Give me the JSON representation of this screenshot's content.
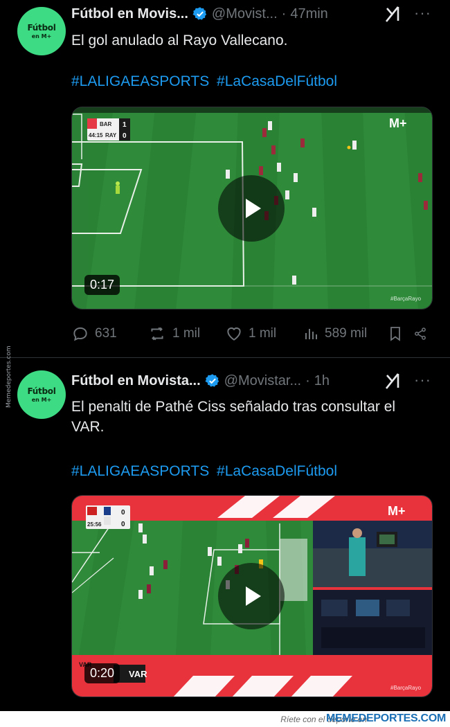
{
  "tweets": [
    {
      "avatar": {
        "title": "Fútbol",
        "sub": "en M+"
      },
      "name": "Fútbol en Movis...",
      "handle": "@Movist...",
      "time": "47min",
      "text": "El gol anulado al Rayo Vallecano.",
      "hashtags": [
        "#LALIGAEASPORTS",
        "#LaCasaDelFútbol"
      ],
      "video": {
        "duration": "0:17",
        "scoreboard": {
          "home": "BAR",
          "away": "RAY",
          "home_score": "1",
          "away_score": "0",
          "clock": "44:15"
        },
        "broadcaster": "M+",
        "watermark": "#BarçaRayo"
      },
      "stats": {
        "replies": "631",
        "reposts": "1 mil",
        "likes": "1 mil",
        "views": "589 mil"
      }
    },
    {
      "avatar": {
        "title": "Fútbol",
        "sub": "en M+"
      },
      "name": "Fútbol en Movista...",
      "handle": "@Movistar...",
      "time": "1h",
      "text": "El penalti de Pathé Ciss señalado tras consultar el VAR.",
      "hashtags": [
        "#LALIGAEASPORTS",
        "#LaCasaDelFútbol"
      ],
      "video": {
        "duration": "0:20",
        "scoreboard": {
          "home_score": "0",
          "away_score": "0",
          "clock": "25:56"
        },
        "var_label": "VAR",
        "var_badge": "VAR",
        "broadcaster": "M+",
        "watermark": "#BarçaRayo"
      }
    }
  ],
  "side_watermark": "Memedeportes.com",
  "footer": {
    "tagline": "Ríete con el deporte en",
    "brand": "MEMEDEPORTES.COM"
  },
  "colors": {
    "accent_blue": "#1d9bf0",
    "muted": "#71767b",
    "avatar_green": "#3ddc84",
    "var_red": "#e8333d"
  }
}
